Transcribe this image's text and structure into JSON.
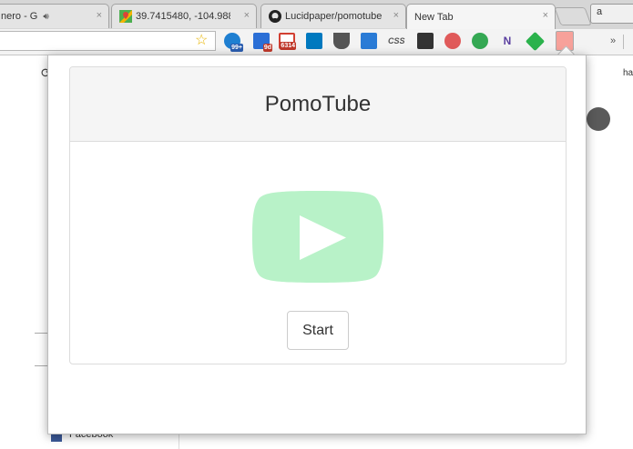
{
  "tabs": [
    {
      "label": "nero - G",
      "has_audio": true,
      "close": "×"
    },
    {
      "label": "39.7415480, -104.988",
      "favicon": "maps-icon",
      "close": "×"
    },
    {
      "label": "Lucidpaper/pomotube",
      "favicon": "github-icon",
      "close": "×"
    },
    {
      "label": "New Tab",
      "active": true,
      "close": "×"
    }
  ],
  "window_button_label": "a",
  "toolbar": {
    "extensions": [
      {
        "name": "skype-ext",
        "badge": "99+",
        "color": "#1f7fd1"
      },
      {
        "name": "stack-ext",
        "badge": "9d",
        "color": "#2b6fd6"
      },
      {
        "name": "gmail-ext",
        "badge": "6314",
        "color": "#d23f31"
      },
      {
        "name": "trello-ext",
        "color": "#0079bf"
      },
      {
        "name": "pocket-ext",
        "color": "#555555"
      },
      {
        "name": "window-ext",
        "color": "#2a7bd6"
      },
      {
        "name": "css-ext",
        "label": "CSS",
        "color": "#555555"
      },
      {
        "name": "pause-ext",
        "color": "#333333"
      },
      {
        "name": "red-ext",
        "color": "#e05a5a"
      },
      {
        "name": "hangouts-ext",
        "color": "#34a853"
      },
      {
        "name": "n-ext",
        "label": "N",
        "color": "#5a3fa0"
      },
      {
        "name": "feedly-ext",
        "color": "#2bb24c"
      },
      {
        "name": "pomotube-ext",
        "color": "#f7a19a"
      }
    ],
    "overflow": "»"
  },
  "page_background": {
    "facebook_label": "Facebook",
    "right_text": "har"
  },
  "popup": {
    "title": "PomoTube",
    "play_color": "#b8f2c8",
    "start_label": "Start"
  }
}
